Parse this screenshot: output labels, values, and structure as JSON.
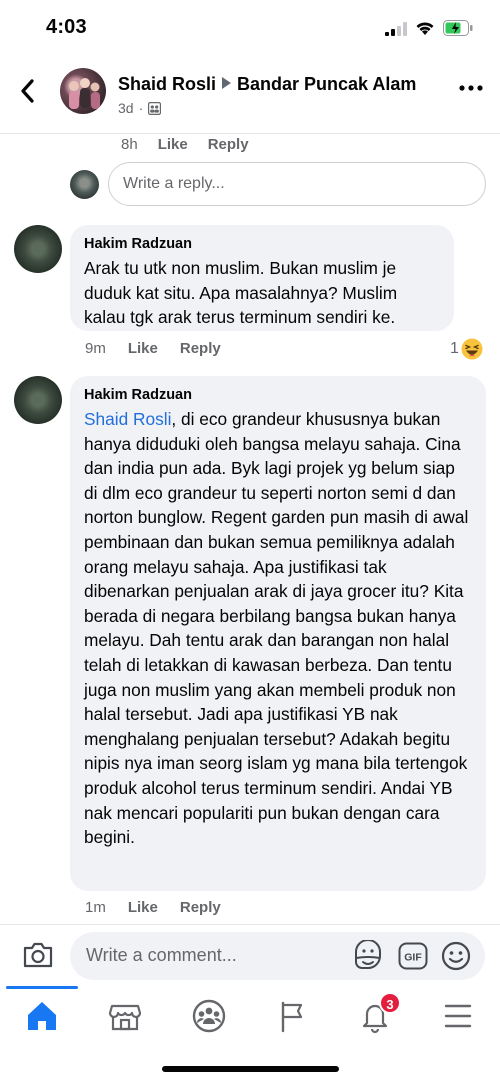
{
  "status_bar": {
    "time": "4:03"
  },
  "header": {
    "author": "Shaid Rosli",
    "group": "Bandar Puncak Alam",
    "age": "3d",
    "separator": "·"
  },
  "top_actions": {
    "time": "8h",
    "like": "Like",
    "reply": "Reply"
  },
  "reply_box": {
    "placeholder": "Write a reply..."
  },
  "comments": [
    {
      "author": "Hakim Radzuan",
      "text": "Arak tu utk non muslim. Bukan muslim je duduk kat situ. Apa masalahnya? Muslim kalau tgk arak terus terminum sendiri ke.",
      "time": "9m",
      "like": "Like",
      "reply": "Reply",
      "reaction_count": "1"
    },
    {
      "author": "Hakim Radzuan",
      "mention": "Shaid Rosli",
      "text": ", di eco grandeur khususnya bukan hanya diduduki oleh bangsa melayu sahaja. Cina dan india pun ada. Byk lagi projek yg belum siap di dlm eco grandeur tu seperti norton semi d dan norton bunglow. Regent garden pun masih di awal pembinaan dan bukan semua pemiliknya adalah orang melayu sahaja. Apa justifikasi tak dibenarkan penjualan arak di jaya grocer itu? Kita berada di negara berbilang bangsa bukan hanya melayu. Dah tentu arak dan barangan non halal telah di letakkan di kawasan berbeza. Dan tentu juga non muslim yang akan membeli produk non halal tersebut. Jadi apa justifikasi YB nak menghalang penjualan tersebut? Adakah begitu nipis nya iman seorg islam yg mana bila tertengok produk alcohol terus terminum sendiri. Andai YB nak mencari populariti pun bukan dengan cara begini.",
      "time": "1m",
      "like": "Like",
      "reply": "Reply"
    }
  ],
  "composer": {
    "placeholder": "Write a comment...",
    "gif_label": "GIF"
  },
  "tab_bar": {
    "notification_count": "3"
  },
  "colors": {
    "accent": "#1877f2",
    "mention": "#216fdb",
    "badge": "#e41e3f",
    "bubble": "#f0f2f5"
  }
}
